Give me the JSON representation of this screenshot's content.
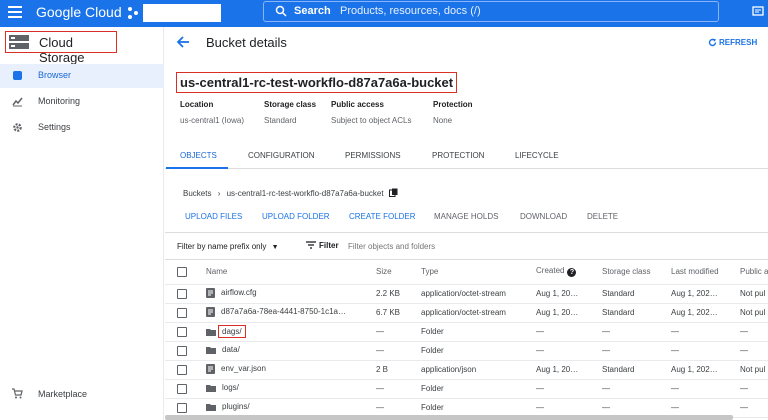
{
  "topbar": {
    "logo": "Google Cloud",
    "search_label": "Search",
    "search_placeholder": "Products, resources, docs (/)"
  },
  "sidebar": {
    "product": "Cloud Storage",
    "items": [
      {
        "label": "Browser",
        "icon": "bucket-icon",
        "active": true
      },
      {
        "label": "Monitoring",
        "icon": "chart-icon",
        "active": false
      },
      {
        "label": "Settings",
        "icon": "gear-icon",
        "active": false
      }
    ],
    "marketplace": "Marketplace"
  },
  "header": {
    "title": "Bucket details",
    "refresh": "REFRESH"
  },
  "bucket": {
    "name": "us-central1-rc-test-workflo-d87a7a6a-bucket",
    "meta": [
      {
        "key": "Location",
        "value": "us-central1 (Iowa)"
      },
      {
        "key": "Storage class",
        "value": "Standard"
      },
      {
        "key": "Public access",
        "value": "Subject to object ACLs"
      },
      {
        "key": "Protection",
        "value": "None"
      }
    ]
  },
  "tabs": [
    "OBJECTS",
    "CONFIGURATION",
    "PERMISSIONS",
    "PROTECTION",
    "LIFECYCLE"
  ],
  "breadcrumb": {
    "root": "Buckets",
    "current": "us-central1-rc-test-workflo-d87a7a6a-bucket"
  },
  "actions": {
    "upload_files": "UPLOAD FILES",
    "upload_folder": "UPLOAD FOLDER",
    "create_folder": "CREATE FOLDER",
    "manage_holds": "MANAGE HOLDS",
    "download": "DOWNLOAD",
    "delete": "DELETE"
  },
  "filter": {
    "prefix": "Filter by name prefix only",
    "label": "Filter",
    "placeholder": "Filter objects and folders"
  },
  "table": {
    "headers": [
      "Name",
      "Size",
      "Type",
      "Created",
      "Storage class",
      "Last modified",
      "Public a"
    ],
    "rows": [
      {
        "name": "airflow.cfg",
        "size": "2.2 KB",
        "type": "application/octet-stream",
        "created": "Aug 1, 20…",
        "storage": "Standard",
        "modified": "Aug 1, 202…",
        "public": "Not pul",
        "kind": "file"
      },
      {
        "name": "d87a7a6a-78ea-4441-8750-1c1a…",
        "size": "6.7 KB",
        "type": "application/octet-stream",
        "created": "Aug 1, 20…",
        "storage": "Standard",
        "modified": "Aug 1, 202…",
        "public": "Not pul",
        "kind": "file"
      },
      {
        "name": "dags/",
        "size": "—",
        "type": "Folder",
        "created": "—",
        "storage": "—",
        "modified": "—",
        "public": "—",
        "kind": "folder"
      },
      {
        "name": "data/",
        "size": "—",
        "type": "Folder",
        "created": "—",
        "storage": "—",
        "modified": "—",
        "public": "—",
        "kind": "folder"
      },
      {
        "name": "env_var.json",
        "size": "2 B",
        "type": "application/json",
        "created": "Aug 1, 20…",
        "storage": "Standard",
        "modified": "Aug 1, 202…",
        "public": "Not pul",
        "kind": "file"
      },
      {
        "name": "logs/",
        "size": "—",
        "type": "Folder",
        "created": "—",
        "storage": "—",
        "modified": "—",
        "public": "—",
        "kind": "folder"
      },
      {
        "name": "plugins/",
        "size": "—",
        "type": "Folder",
        "created": "—",
        "storage": "—",
        "modified": "—",
        "public": "—",
        "kind": "folder"
      }
    ]
  },
  "colors": {
    "brand": "#1a73e8",
    "highlight": "#d93025"
  }
}
